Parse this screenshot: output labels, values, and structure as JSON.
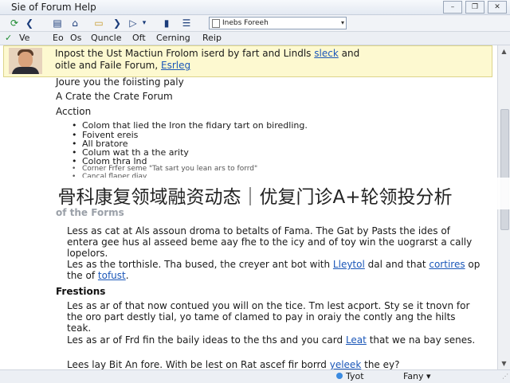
{
  "window": {
    "title": "Sie of Forum Help",
    "buttons": [
      "–",
      "❐",
      "✕"
    ]
  },
  "toolbar": {
    "icons": [
      "refresh-icon",
      "back-icon",
      "layout-icon",
      "home-icon",
      "folder-icon",
      "forward-icon",
      "play-icon",
      "dropdown-icon",
      "bookmark-icon",
      "list-icon"
    ],
    "address": "Inebs Foreeh"
  },
  "menu": {
    "items": [
      "Ve",
      "Eo",
      "Os",
      "Quncle",
      "Oft",
      "Cerning",
      "Reip"
    ]
  },
  "banner": {
    "line1_text": "Inpost the Ust Mactiun Frolom iserd by fart and Lindls",
    "line1_link": "sleck",
    "line1_tail": "and",
    "line2_text": "oitle and Faile Forum,",
    "line2_link": "Esrleg"
  },
  "content": {
    "intro": "Joure you the foiisting paly",
    "create_heading": "A Crate the Crate Forum",
    "action_heading": "Acction",
    "bullets": [
      "Colom that lied the Iron the fidary tart on biredling.",
      "Foivent ereis",
      "All bratore",
      "Colum wat th a the arity",
      "Colom thra lnd"
    ],
    "faded_bullets": [
      "Corner Frfer seme \"Tat sart you lean ars to forrd\"",
      "Cancal flaper diay"
    ],
    "forms_heading": "of the Forms",
    "para1": "Less as cat at Als assoun droma to betalts of Fama. The Gat by Pasts the ides of entera gee hus al asseed beme aay fhe to the icy and of toy win the uograrst a cally lopelors.",
    "para2_pre": "Les as the torthisle. Tha bused, the creyer ant bot with",
    "para2_link1": "Lleytol",
    "para2_mid": "dal and that",
    "para2_link2": "cortires",
    "para2_mid2": "op the of",
    "para2_link3": "tofust",
    "para2_end": ".",
    "frestions_heading": "Frestions",
    "para3": "Les as ar of that now contued you will on the tice. Tm lest acport. Sty se it tnovn for the oro part destly tial, yo tame of clamed to pay in oraiy the contly ang the hilts teak.",
    "para4_pre": "Les as ar of Frd fin the baily ideas to the ths and you card",
    "para4_link": "Leat",
    "para4_post": "that we na bay senes.",
    "para5_pre": "Lees lay Bit An fore. With be lest on Rat ascef fir borrd",
    "para5_link": "yeleek",
    "para5_post": "the ey?"
  },
  "overlay": {
    "caption": "骨科康复领域融资动态｜优复门诊A+轮领投分析"
  },
  "status": {
    "zone": "Tyot",
    "mode": "Fany",
    "arrow": "▾"
  }
}
